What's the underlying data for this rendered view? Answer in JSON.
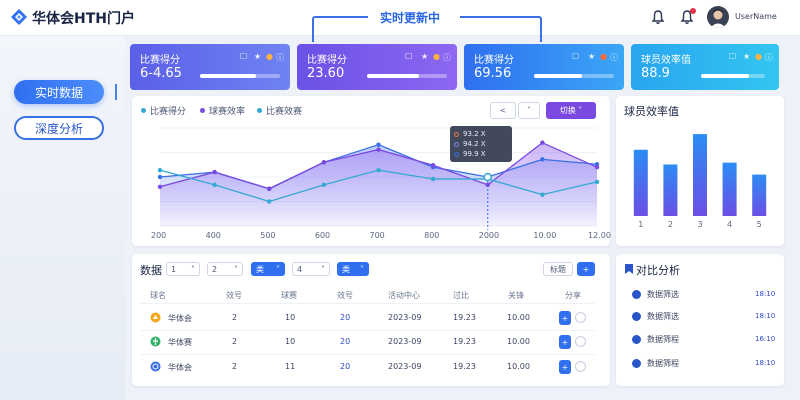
{
  "app": {
    "title": "华体会HTH门户"
  },
  "header": {
    "live_tab": "实时更新中",
    "user_name": "UserName"
  },
  "nav": {
    "items": [
      {
        "label": "实时数据",
        "active": true
      },
      {
        "label": "深度分析",
        "active": false
      }
    ]
  },
  "cards": [
    {
      "title": "比赛得分",
      "value": "6-4.65",
      "progress": 0.7,
      "gradient": [
        "#5b5fe8",
        "#6f83f2"
      ]
    },
    {
      "title": "比赛得分",
      "value": "23.60",
      "progress": 0.65,
      "gradient": [
        "#6b51e6",
        "#8d67f1"
      ]
    },
    {
      "title": "比赛得分",
      "value": "69.56",
      "progress": 0.6,
      "gradient": [
        "#2f6ff0",
        "#3ba6f6"
      ]
    },
    {
      "title": "球员效率值",
      "value": "88.9",
      "progress": 0.75,
      "gradient": [
        "#28a5f0",
        "#33c6f0"
      ]
    }
  ],
  "line_panel": {
    "legend": [
      {
        "label": "比赛得分",
        "color": "#33a9d3"
      },
      {
        "label": "球赛效率",
        "color": "#7a49e0"
      },
      {
        "label": "比赛效赛",
        "color": "#33a9d3"
      }
    ],
    "controls": {
      "prev": "<",
      "dropdown": "˅",
      "purple": "切换"
    },
    "tooltip": {
      "rows": [
        {
          "value": "93.2 X",
          "color": "#e57a4a"
        },
        {
          "value": "94.2 X",
          "color": "#7a8cf4"
        },
        {
          "value": "99.9 X",
          "color": "#3b6fe4"
        }
      ]
    }
  },
  "chart_data": [
    {
      "type": "line",
      "x": [
        "200",
        "400",
        "500",
        "600",
        "700",
        "800",
        "2000",
        "10.00",
        "12.00"
      ],
      "series": [
        {
          "name": "比赛得分",
          "color": "#3b6fe4",
          "values": [
            50,
            55,
            38,
            65,
            83,
            60,
            50,
            68,
            63
          ]
        },
        {
          "name": "球赛效率",
          "color": "#7a49e0",
          "values": [
            40,
            55,
            38,
            65,
            78,
            62,
            42,
            85,
            60
          ]
        },
        {
          "name": "比赛效赛",
          "color": "#33a9d3",
          "values": [
            57,
            42,
            25,
            42,
            57,
            48,
            48,
            32,
            45
          ]
        }
      ],
      "xticks": [
        "200",
        "400",
        "500",
        "600",
        "700",
        "800",
        "2000",
        "10.00",
        "12.00"
      ],
      "ylim": [
        0,
        100
      ]
    },
    {
      "type": "bar",
      "title": "球员效率值",
      "categories": [
        "1",
        "2",
        "3",
        "4",
        "5"
      ],
      "values": [
        72,
        56,
        89,
        58,
        45
      ],
      "ylim": [
        0,
        100
      ]
    }
  ],
  "table_panel": {
    "title": "数据",
    "filters": [
      "1",
      "2",
      "类",
      "4",
      "类"
    ],
    "search_label": "标题",
    "add_label": "+",
    "headers": [
      "球名",
      "效号",
      "球赛",
      "效号",
      "活动中心",
      "过比",
      "关锋",
      "分享"
    ],
    "rows": [
      {
        "team": "华体会",
        "a": "2",
        "b": "10",
        "c": "20",
        "date": "2023-09",
        "score": "19.23",
        "time": "10.00"
      },
      {
        "team": "华体赛",
        "a": "2",
        "b": "10",
        "c": "20",
        "date": "2023-09",
        "score": "19.23",
        "time": "10.00"
      },
      {
        "team": "华体会",
        "a": "2",
        "b": "11",
        "c": "20",
        "date": "2023-09",
        "score": "19.23",
        "time": "10.00"
      }
    ]
  },
  "compare_panel": {
    "title": "对比分析",
    "items": [
      {
        "label": "数据筛选",
        "time": "18:10"
      },
      {
        "label": "数据筛选",
        "time": "18:10"
      },
      {
        "label": "数据筛程",
        "time": "16:10"
      },
      {
        "label": "数据筛程",
        "time": "18:10"
      }
    ]
  }
}
